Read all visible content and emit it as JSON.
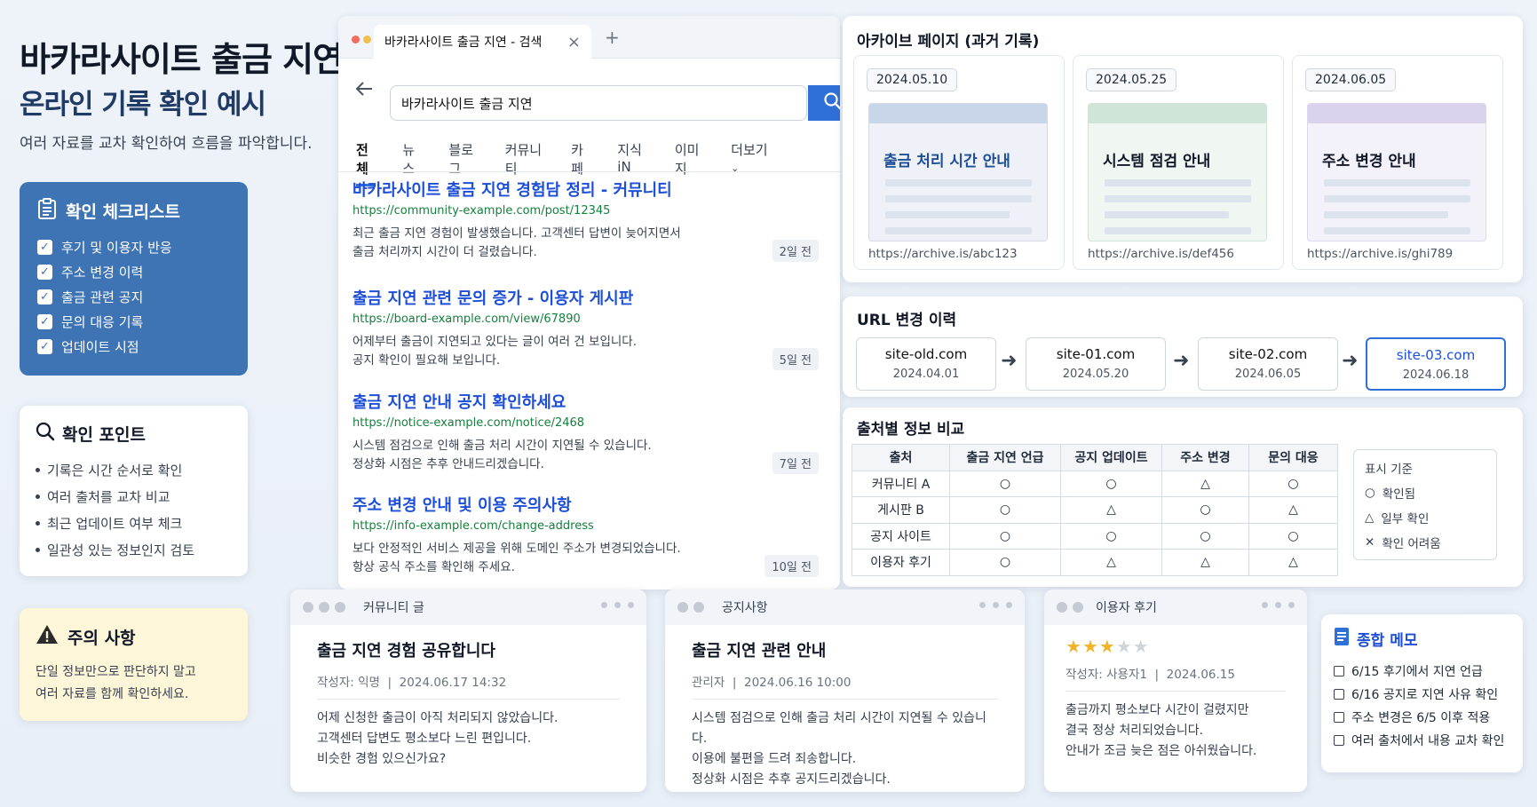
{
  "header": {
    "title_line1": "바카라사이트 출금 지연",
    "title_line2": "온라인 기록 확인 예시",
    "subtitle": "여러 자료를 교차 확인하여 흐름을 파악합니다."
  },
  "checklist": {
    "title": "확인 체크리스트",
    "items": [
      "후기 및 이용자 반응",
      "주소 변경 이력",
      "출금 관련 공지",
      "문의 대응 기록",
      "업데이트 시점"
    ]
  },
  "points": {
    "title": "확인 포인트",
    "items": [
      "기록은 시간 순서로 확인",
      "여러 출처를 교차 비교",
      "최근 업데이트 여부 체크",
      "일관성 있는 정보인지 검토"
    ]
  },
  "caution": {
    "title": "주의 사항",
    "line1": "단일 정보만으로 판단하지 말고",
    "line2": "여러 자료를 함께 확인하세요."
  },
  "browser": {
    "tab_title": "바카라사이트 출금 지연 - 검색",
    "tab_close": "×",
    "new_tab": "+",
    "search_query": "바카라사이트 출금 지연",
    "nav_tabs": [
      "전체",
      "뉴스",
      "블로그",
      "커뮤니티",
      "카페",
      "지식iN",
      "이미지",
      "더보기"
    ],
    "results": [
      {
        "title": "바카라사이트 출금 지연 경험담 정리 - 커뮤니티",
        "url": "https://community-example.com/post/12345",
        "desc1": "최근 출금 지연 경험이 발생했습니다. 고객센터 답변이 늦어지면서",
        "desc2": "출금 처리까지 시간이 더 걸렸습니다.",
        "time": "2일 전"
      },
      {
        "title": "출금 지연 관련 문의 증가 - 이용자 게시판",
        "url": "https://board-example.com/view/67890",
        "desc1": "어제부터 출금이 지연되고 있다는 글이 여러 건 보입니다.",
        "desc2": "공지 확인이 필요해 보입니다.",
        "time": "5일 전"
      },
      {
        "title": "출금 지연 안내 공지 확인하세요",
        "url": "https://notice-example.com/notice/2468",
        "desc1": "시스템 점검으로 인해 출금 처리 시간이 지연될 수 있습니다.",
        "desc2": "정상화 시점은 추후 안내드리겠습니다.",
        "time": "7일 전"
      },
      {
        "title": "주소 변경 안내 및 이용 주의사항",
        "url": "https://info-example.com/change-address",
        "desc1": "보다 안정적인 서비스 제공을 위해 도메인 주소가 변경되었습니다.",
        "desc2": "항상 공식 주소를 확인해 주세요.",
        "time": "10일 전"
      }
    ]
  },
  "archive": {
    "title": "아카이브 페이지 (과거 기록)",
    "cards": [
      {
        "date": "2024.05.10",
        "heading": "출금 처리 시간 안내",
        "url": "https://archive.is/abc123",
        "color": "#c9d6ea",
        "head_color": "#1f4e96"
      },
      {
        "date": "2024.05.25",
        "heading": "시스템 점검 안내",
        "url": "https://archive.is/def456",
        "color": "#cfe5d8",
        "head_color": "#111827"
      },
      {
        "date": "2024.06.05",
        "heading": "주소 변경 안내",
        "url": "https://archive.is/ghi789",
        "color": "#d9d3ee",
        "head_color": "#111827"
      }
    ]
  },
  "url_history": {
    "title": "URL 변경 이력",
    "items": [
      {
        "url": "site-old.com",
        "date": "2024.04.01"
      },
      {
        "url": "site-01.com",
        "date": "2024.05.20"
      },
      {
        "url": "site-02.com",
        "date": "2024.06.05"
      },
      {
        "url": "site-03.com",
        "date": "2024.06.18"
      }
    ]
  },
  "compare": {
    "title": "출처별 정보 비교",
    "headers": [
      "출처",
      "출금 지연 언급",
      "공지 업데이트",
      "주소 변경",
      "문의 대응"
    ],
    "rows": [
      [
        "커뮤니티 A",
        "○",
        "○",
        "△",
        "○"
      ],
      [
        "게시판 B",
        "○",
        "△",
        "○",
        "△"
      ],
      [
        "공지 사이트",
        "○",
        "○",
        "○",
        "○"
      ],
      [
        "이용자 후기",
        "○",
        "△",
        "△",
        "△"
      ]
    ],
    "legend": {
      "title": "표시 기준",
      "items": [
        {
          "sym": "○",
          "label": "확인됨"
        },
        {
          "sym": "△",
          "label": "일부 확인"
        },
        {
          "sym": "✕",
          "label": "확인 어려움"
        }
      ]
    }
  },
  "posts": [
    {
      "window": "커뮤니티 글",
      "title": "출금 지연 경험 공유합니다",
      "author": "작성자: 익명",
      "date": "2024.06.17 14:32",
      "lines": [
        "어제 신청한 출금이 아직 처리되지 않았습니다.",
        "고객센터 답변도 평소보다 느린 편입니다.",
        "비슷한 경험 있으신가요?"
      ]
    },
    {
      "window": "공지사항",
      "title": "출금 지연 관련 안내",
      "author": "관리자",
      "date": "2024.06.16 10:00",
      "lines": [
        "시스템 점검으로 인해 출금 처리 시간이 지연될 수 있습니다.",
        "이용에 불편을 드려 죄송합니다.",
        "정상화 시점은 추후 공지드리겠습니다."
      ]
    },
    {
      "window": "이용자 후기",
      "rating": 3,
      "rating_max": 5,
      "author": "작성자: 사용자1",
      "date": "2024.06.15",
      "lines": [
        "출금까지 평소보다 시간이 걸렸지만",
        "결국 정상 처리되었습니다.",
        "안내가 조금 늦은 점은 아쉬웠습니다."
      ]
    }
  ],
  "memo": {
    "title": "종합 메모",
    "items": [
      "6/15 후기에서 지연 언급",
      "6/16 공지로 지연 사유 확인",
      "주소 변경은 6/5 이후 적용",
      "여러 출처에서 내용 교차 확인"
    ]
  },
  "colors": {
    "accent": "#2f6fd8",
    "checklist_bg": "#3f74b4",
    "caution_bg": "#fdf6d8",
    "star": "#f0b429"
  }
}
